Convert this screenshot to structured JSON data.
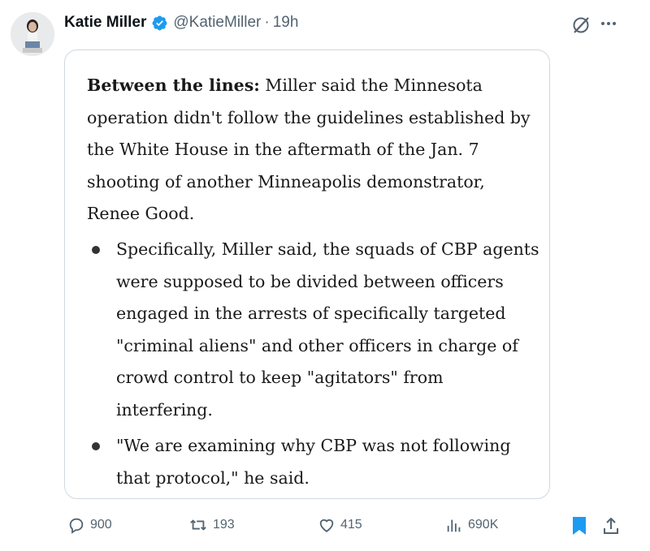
{
  "post": {
    "author_name": "Katie Miller",
    "handle": "@KatieMiller",
    "separator": "·",
    "time": "19h"
  },
  "card": {
    "lead_bold": "Between the lines:",
    "lead_text": " Miller said the Minnesota operation didn't follow the guidelines established by the White House in the aftermath of the Jan. 7 shooting of another Minneapolis demonstrator, Renee Good.",
    "bullets": [
      "Specifically, Miller said, the squads of CBP agents were supposed to be divided between officers engaged in the arrests of specifically targeted \"criminal aliens\" and other officers in charge of crowd control to keep \"agitators\" from interfering.",
      "\"We are examining why CBP was not following that protocol,\" he said."
    ]
  },
  "actions": {
    "replies": "900",
    "reposts": "193",
    "likes": "415",
    "views": "690K"
  },
  "icons": {
    "verified": "verified-badge-icon",
    "grok": "grok-icon",
    "more": "more-icon",
    "reply": "reply-icon",
    "repost": "repost-icon",
    "like": "heart-icon",
    "views": "views-icon",
    "bookmark": "bookmark-icon",
    "share": "share-icon"
  },
  "colors": {
    "verified_blue": "#1d9bf0",
    "muted": "#536471",
    "bookmark_blue": "#1d9bf0"
  }
}
